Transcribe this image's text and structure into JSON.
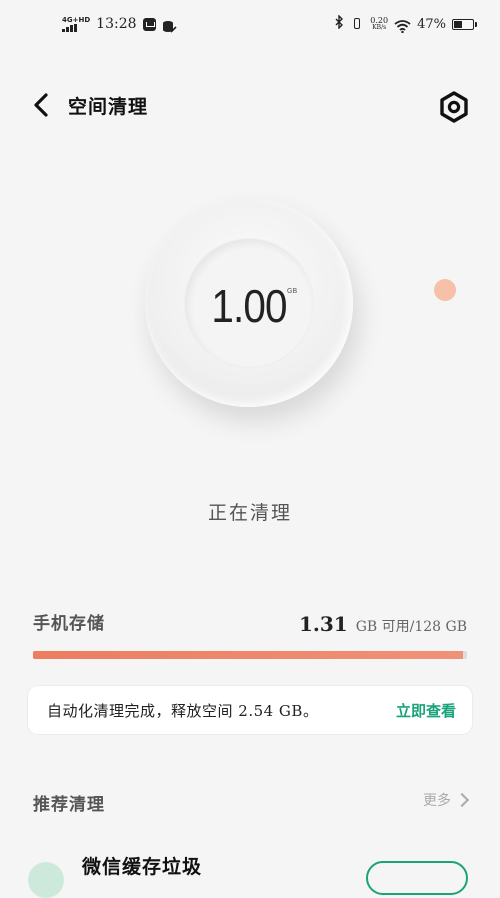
{
  "status_bar": {
    "network": "4G+HD",
    "time": "13:28",
    "speed_value": "0.20",
    "speed_unit": "KB/s",
    "battery_percent": "47%",
    "battery_level": 0.47
  },
  "header": {
    "title": "空间清理"
  },
  "dial": {
    "value": "1.00",
    "unit": "GB"
  },
  "status_text": "正在清理",
  "storage": {
    "label": "手机存储",
    "available": "1.31",
    "detail": "GB 可用/128 GB",
    "used_fraction": 0.99
  },
  "notice": {
    "text": "自动化清理完成，释放空间 2.54 GB。",
    "action": "立即查看"
  },
  "recommend": {
    "label": "推荐清理",
    "more": "更多",
    "item_title": "微信缓存垃圾"
  },
  "colors": {
    "accent_green": "#1aa37a",
    "progress_orange": "#ec7d5f",
    "dot_orange": "#f6c1a8"
  }
}
